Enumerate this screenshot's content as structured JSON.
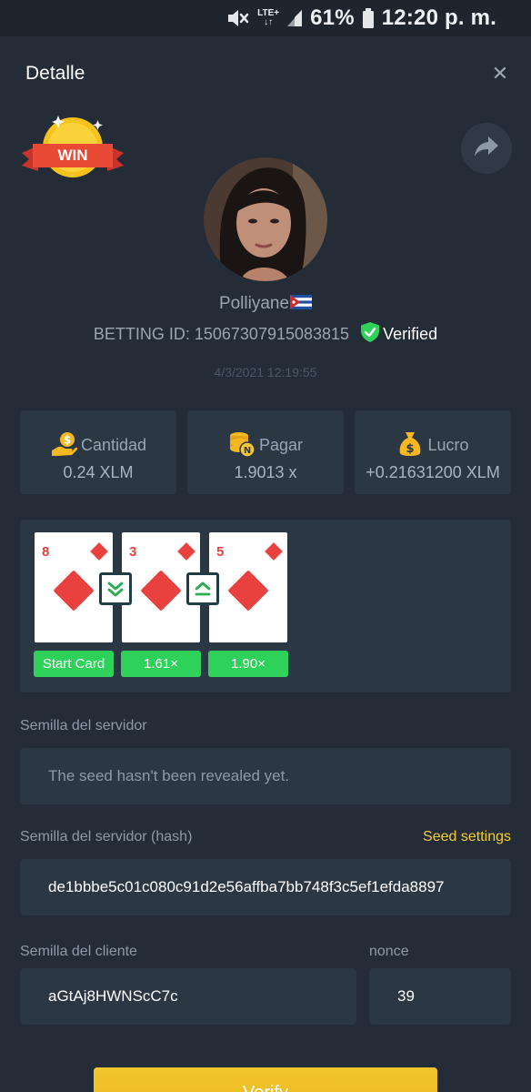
{
  "status_bar": {
    "network": "LTE+",
    "battery": "61%",
    "time": "12:20 p. m.",
    "icons": [
      "mute-icon",
      "signal-icon",
      "battery-icon"
    ]
  },
  "header": {
    "title": "Detalle",
    "close_icon": "close-icon"
  },
  "badge": {
    "label": "WIN"
  },
  "share_icon": "share-icon",
  "user": {
    "name": "Polliyane",
    "flag": "cuba-flag-icon",
    "betting_id": "BETTING ID: 15067307915083815",
    "verified_label": "Verified",
    "datetime": "4/3/2021 12:19:55"
  },
  "stats": [
    {
      "label": "Cantidad",
      "value": "0.24 XLM",
      "icon": "coin-hand-icon"
    },
    {
      "label": "Pagar",
      "value": "1.9013 x",
      "icon": "coin-stack-icon"
    },
    {
      "label": "Lucro",
      "value": "+0.21631200 XLM",
      "icon": "money-bag-icon"
    }
  ],
  "game": {
    "cards": [
      {
        "rank": "8",
        "suit": "diamonds",
        "multiplier": "Start Card"
      },
      {
        "rank": "3",
        "suit": "diamonds",
        "multiplier": "1.61×"
      },
      {
        "rank": "5",
        "suit": "diamonds",
        "multiplier": "1.90×"
      }
    ],
    "guesses": [
      "lower",
      "higher"
    ]
  },
  "server_seed": {
    "label": "Semilla del servidor",
    "value": "The seed hasn't been revealed yet."
  },
  "server_seed_hash": {
    "label": "Semilla del servidor (hash)",
    "link": "Seed settings",
    "value": "de1bbbe5c01c080c91d2e56affba7bb748f3c5ef1efda8897"
  },
  "client_seed": {
    "label": "Semilla del cliente",
    "value": "aGtAj8HWNScC7c"
  },
  "nonce": {
    "label": "nonce",
    "value": "39"
  },
  "verify_button": {
    "label": "Verify"
  },
  "colors": {
    "background": "#242d37",
    "panel": "#2c3744",
    "accent_yellow": "#f5cd32",
    "green": "#2ed15a",
    "card_red": "#e8413f"
  }
}
